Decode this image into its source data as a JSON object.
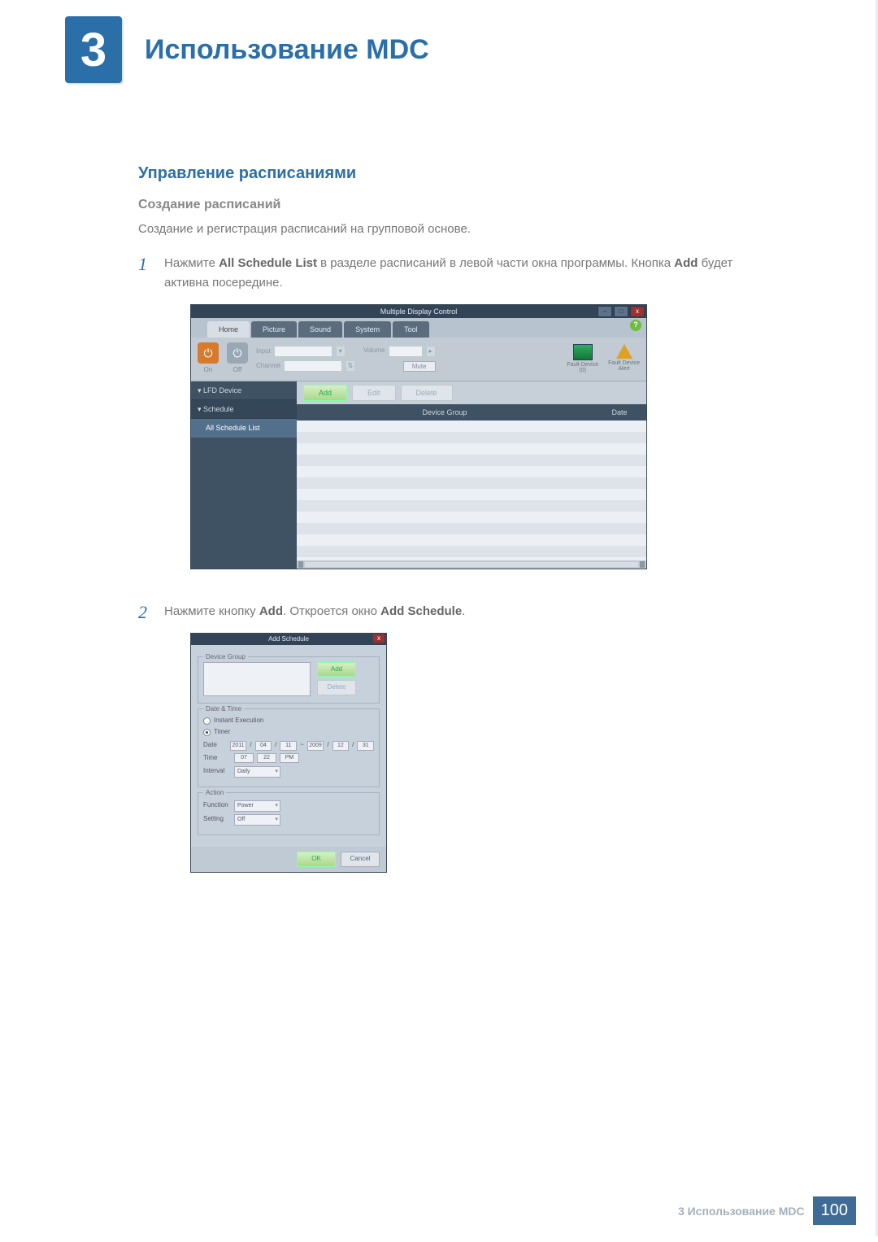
{
  "chapter": {
    "number": "3",
    "title": "Использование MDC"
  },
  "h2": "Управление расписаниями",
  "h3": "Создание расписаний",
  "p_intro": "Создание и регистрация расписаний на групповой основе.",
  "steps": {
    "s1": {
      "num": "1",
      "t1": "Нажмите ",
      "t2": "All Schedule List",
      "t3": " в разделе расписаний в левой части окна программы. Кнопка ",
      "t4": "Add",
      "t5": " будет активна посередине."
    },
    "s2": {
      "num": "2",
      "t1": "Нажмите кнопку ",
      "t2": "Add",
      "t3": ". Откроется окно ",
      "t4": "Add Schedule",
      "t5": "."
    }
  },
  "mdc": {
    "title": "Multiple Display Control",
    "help": "?",
    "winbtn_min": "–",
    "winbtn_max": "□",
    "winbtn_close": "x",
    "tabs": {
      "home": "Home",
      "picture": "Picture",
      "sound": "Sound",
      "system": "System",
      "tool": "Tool"
    },
    "power_on": "On",
    "power_off": "Off",
    "input": "Input",
    "channel": "Channel",
    "volume": "Volume",
    "mute": "Mute",
    "fault0": "Fault Device\n(0)",
    "fault_alert": "Fault Device\nAlert",
    "side_lfd": "▾ LFD Device",
    "side_sched": "▾ Schedule",
    "side_all": "All Schedule List",
    "btn_add": "Add",
    "btn_edit": "Edit",
    "btn_delete": "Delete",
    "col_group": "Device Group",
    "col_date": "Date"
  },
  "sched": {
    "title": "Add Schedule",
    "close": "x",
    "grp_device": "Device Group",
    "btn_add": "Add",
    "btn_delete": "Delete",
    "grp_datetime": "Date & Time",
    "radio_instant": "Instant Execution",
    "radio_timer": "Timer",
    "lbl_date": "Date",
    "lbl_time": "Time",
    "lbl_interval": "Interval",
    "date_y1": "2011",
    "date_m1": "04",
    "date_d1": "11",
    "date_sep": "~",
    "date_y2": "2009",
    "date_m2": "12",
    "date_d2": "31",
    "time_h": "07",
    "time_m": "22",
    "time_ap": "PM",
    "interval_val": "Daily",
    "grp_action": "Action",
    "lbl_function": "Function",
    "lbl_setting": "Setting",
    "function_val": "Power",
    "setting_val": "Off",
    "btn_ok": "OK",
    "btn_cancel": "Cancel"
  },
  "footer": {
    "crumb": "3 Использование MDC",
    "page": "100"
  }
}
